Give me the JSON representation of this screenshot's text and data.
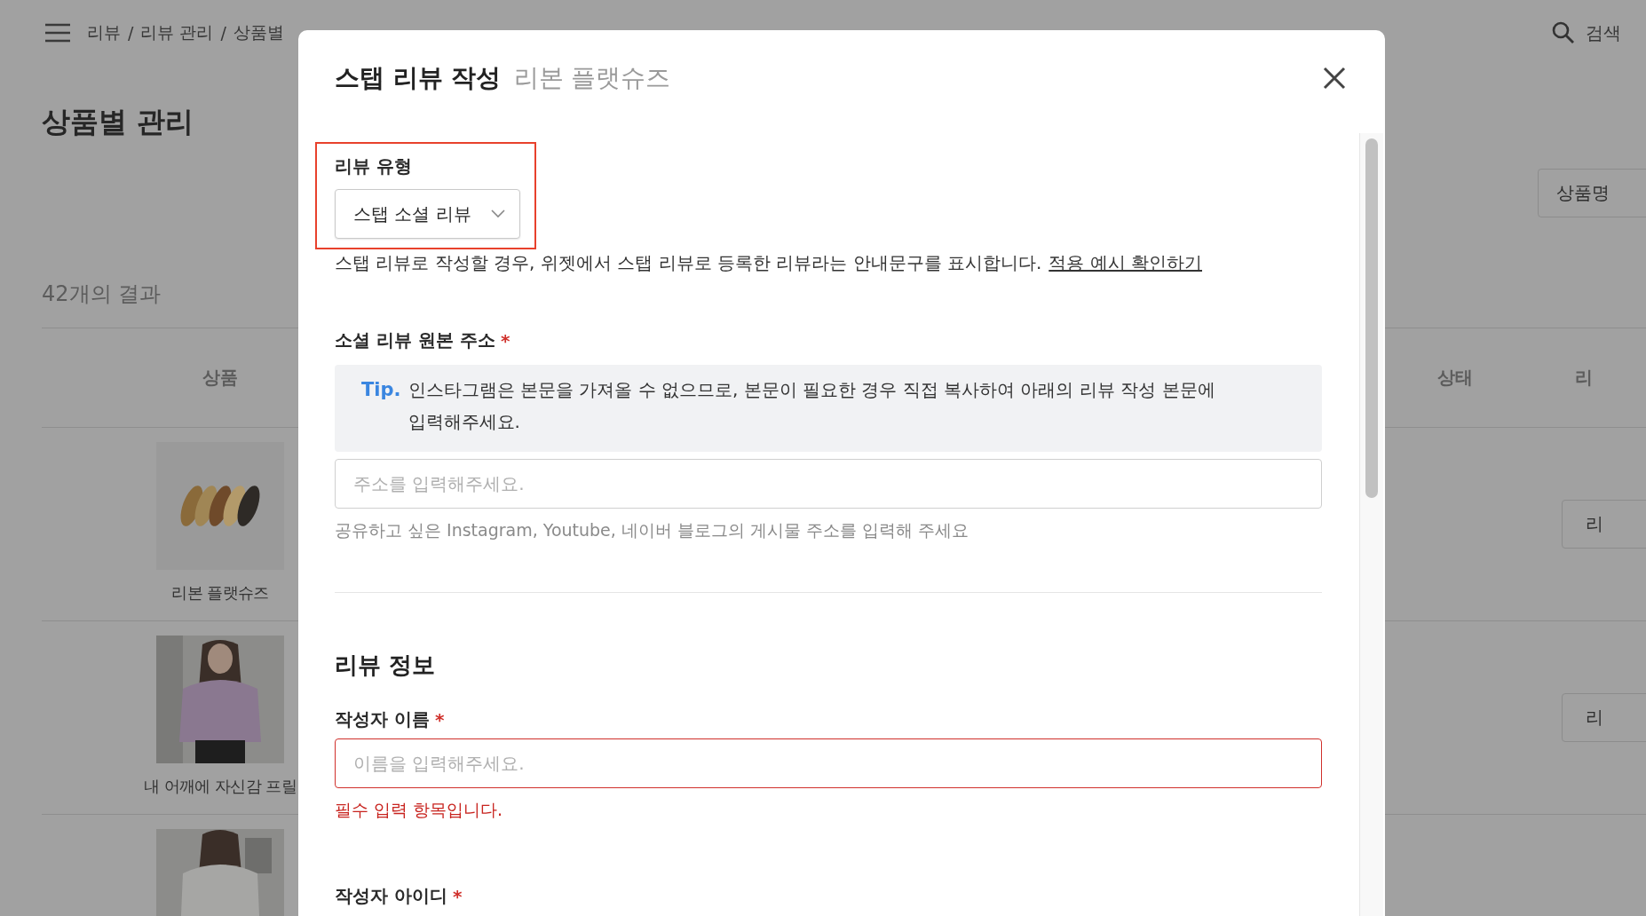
{
  "page": {
    "breadcrumb": {
      "items": [
        "리뷰",
        "리뷰 관리",
        "상품별"
      ],
      "separator": "/"
    },
    "search_label": "검색",
    "title": "상품별 관리",
    "filter_button": "상품명",
    "result_count": "42개의 결과",
    "table": {
      "columns": [
        "상품",
        "상태",
        "리"
      ],
      "rows": [
        {
          "kind": "shoes",
          "product": "리본 플랫슈즈",
          "action": "리"
        },
        {
          "kind": "blouse",
          "product": "내 어깨에 자신감 프릴",
          "action": "리"
        },
        {
          "kind": "shirt"
        }
      ]
    }
  },
  "modal": {
    "title": "스탭 리뷰 작성",
    "subtitle": "리본 플랫슈즈",
    "review_type": {
      "label": "리뷰 유형",
      "value": "스탭 소셜 리뷰",
      "highlighted": true
    },
    "hint": {
      "text": "스탭 리뷰로 작성할 경우, 위젯에서 스탭 리뷰로 등록한 리뷰라는 안내문구를 표시합니다.",
      "link": "적용 예시 확인하기"
    },
    "source_url": {
      "label": "소셜 리뷰 원본 주소",
      "mark": "*",
      "tip_label": "Tip.",
      "tip": "인스타그램은 본문을 가져올 수 없으므로, 본문이 필요한 경우 직접 복사하여 아래의 리뷰 작성 본문에 입력해주세요.",
      "placeholder": "주소를 입력해주세요.",
      "help": "공유하고 싶은 Instagram, Youtube, 네이버 블로그의 게시물 주소를 입력해 주세요"
    },
    "section_title": "리뷰 정보",
    "author_name": {
      "label": "작성자 이름",
      "mark": "*",
      "placeholder": "이름을 입력해주세요.",
      "invalid": true,
      "error": "필수 입력 항목입니다."
    },
    "author_id": {
      "label": "작성자 아이디",
      "mark": "*"
    }
  }
}
